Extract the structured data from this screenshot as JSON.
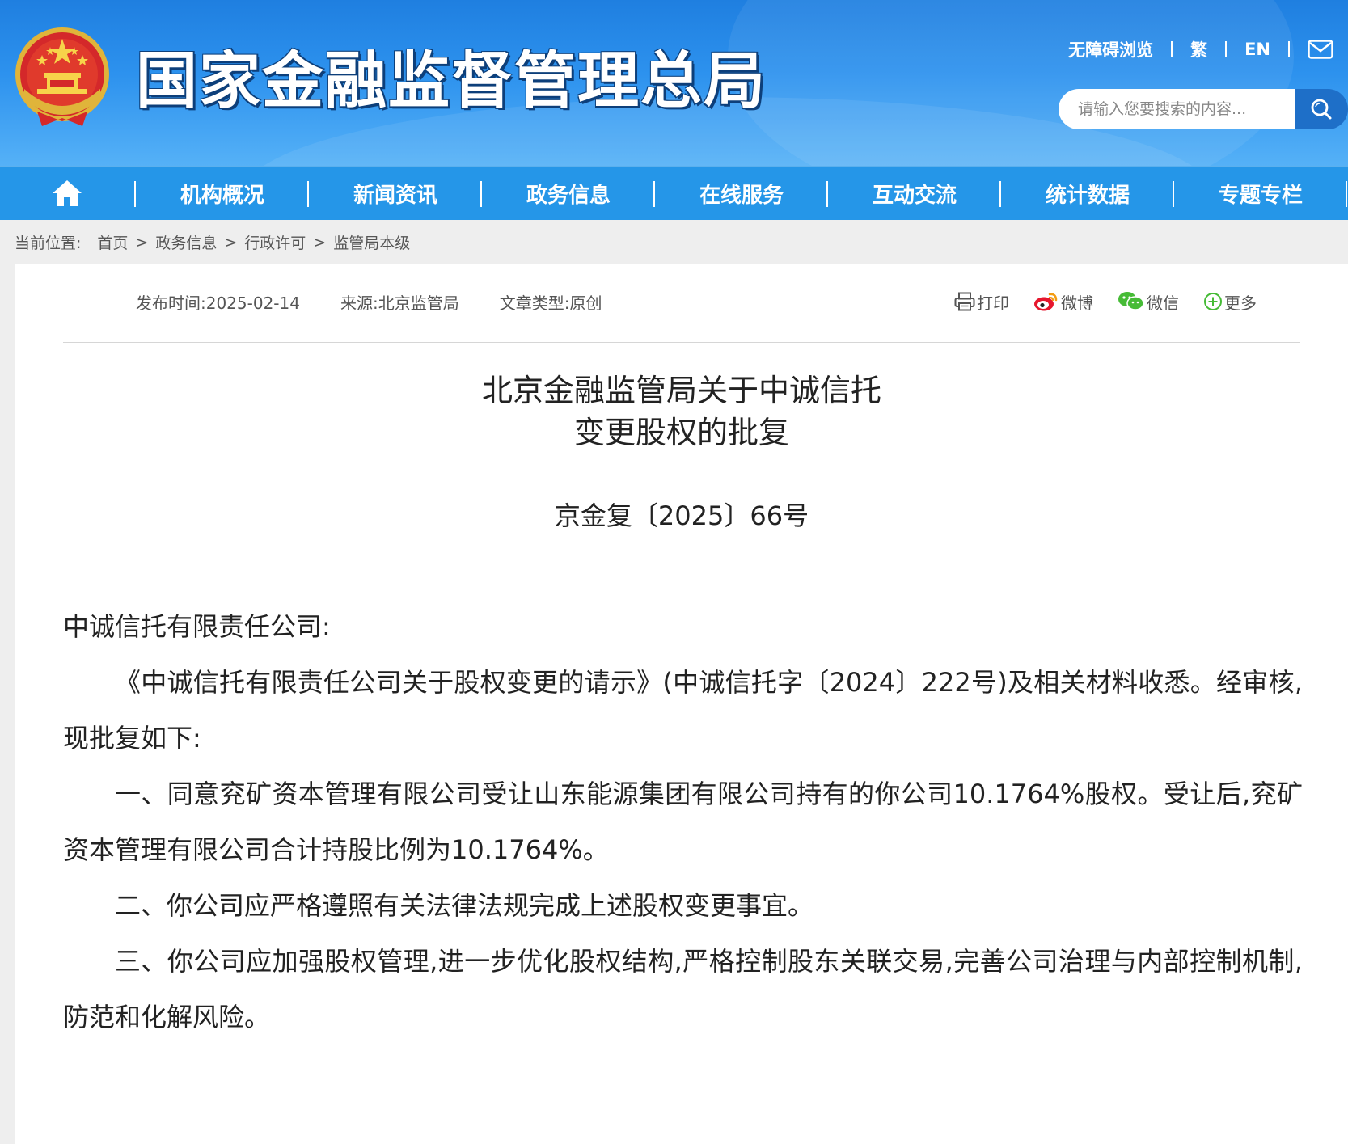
{
  "header": {
    "site_title": "国家金融监督管理总局",
    "top_links": {
      "accessibility": "无障碍浏览",
      "traditional": "繁",
      "english": "EN"
    },
    "search": {
      "placeholder": "请输入您要搜索的内容..."
    }
  },
  "nav": {
    "items": [
      "机构概况",
      "新闻资讯",
      "政务信息",
      "在线服务",
      "互动交流",
      "统计数据",
      "专题专栏"
    ]
  },
  "breadcrumb": {
    "label": "当前位置:",
    "items": [
      "首页",
      "政务信息",
      "行政许可",
      "监管局本级"
    ],
    "arrow": ">"
  },
  "article": {
    "publish_time": "发布时间:2025-02-14",
    "source": "来源:北京监管局",
    "article_type": "文章类型:原创",
    "share": {
      "print": "打印",
      "weibo": "微博",
      "wechat": "微信",
      "more": "更多"
    },
    "title_line1": "北京金融监管局关于中诚信托",
    "title_line2": "变更股权的批复",
    "doc_number": "京金复〔2025〕66号",
    "salutation": "中诚信托有限责任公司:",
    "paragraphs": [
      "《中诚信托有限责任公司关于股权变更的请示》(中诚信托字〔2024〕222号)及相关材料收悉。经审核,现批复如下:",
      "一、同意兖矿资本管理有限公司受让山东能源集团有限公司持有的你公司10.1764%股权。受让后,兖矿资本管理有限公司合计持股比例为10.1764%。",
      "二、你公司应严格遵照有关法律法规完成上述股权变更事宜。",
      "三、你公司应加强股权管理,进一步优化股权结构,严格控制股东关联交易,完善公司治理与内部控制机制,防范和化解风险。"
    ]
  },
  "colors": {
    "header_blue": "#1f7fe0",
    "nav_blue": "#2596e8",
    "search_button": "#1e6fc8"
  }
}
